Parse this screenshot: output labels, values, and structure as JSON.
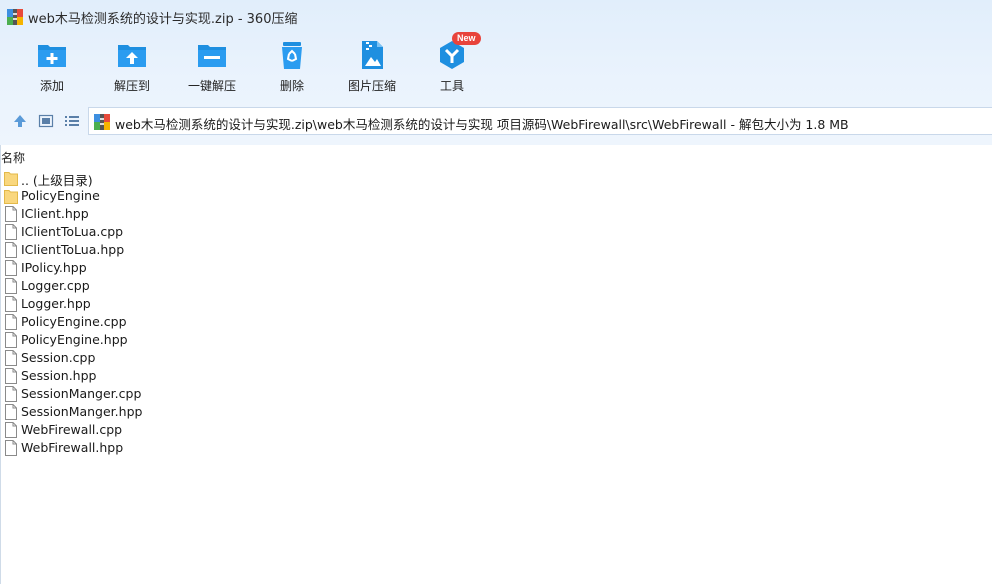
{
  "window": {
    "title": "web木马检测系统的设计与实现.zip - 360压缩"
  },
  "toolbar": {
    "add_label": "添加",
    "extract_to_label": "解压到",
    "one_click_extract_label": "一键解压",
    "delete_label": "删除",
    "image_compress_label": "图片压缩",
    "tools_label": "工具",
    "tools_badge": "New"
  },
  "navigation": {
    "path": "web木马检测系统的设计与实现.zip\\web木马检测系统的设计与实现 项目源码\\WebFirewall\\src\\WebFirewall - 解包大小为 1.8 MB"
  },
  "columns": {
    "name": "名称"
  },
  "files": [
    {
      "name": ".. (上级目录)",
      "type": "folder"
    },
    {
      "name": "PolicyEngine",
      "type": "folder"
    },
    {
      "name": "IClient.hpp",
      "type": "file"
    },
    {
      "name": "IClientToLua.cpp",
      "type": "file"
    },
    {
      "name": "IClientToLua.hpp",
      "type": "file"
    },
    {
      "name": "IPolicy.hpp",
      "type": "file"
    },
    {
      "name": "Logger.cpp",
      "type": "file"
    },
    {
      "name": "Logger.hpp",
      "type": "file"
    },
    {
      "name": "PolicyEngine.cpp",
      "type": "file"
    },
    {
      "name": "PolicyEngine.hpp",
      "type": "file"
    },
    {
      "name": "Session.cpp",
      "type": "file"
    },
    {
      "name": "Session.hpp",
      "type": "file"
    },
    {
      "name": "SessionManger.cpp",
      "type": "file"
    },
    {
      "name": "SessionManger.hpp",
      "type": "file"
    },
    {
      "name": "WebFirewall.cpp",
      "type": "file"
    },
    {
      "name": "WebFirewall.hpp",
      "type": "file"
    }
  ],
  "colors": {
    "accent": "#1e8fe0",
    "folder": "#f9d77e",
    "badge": "#e8433b"
  }
}
